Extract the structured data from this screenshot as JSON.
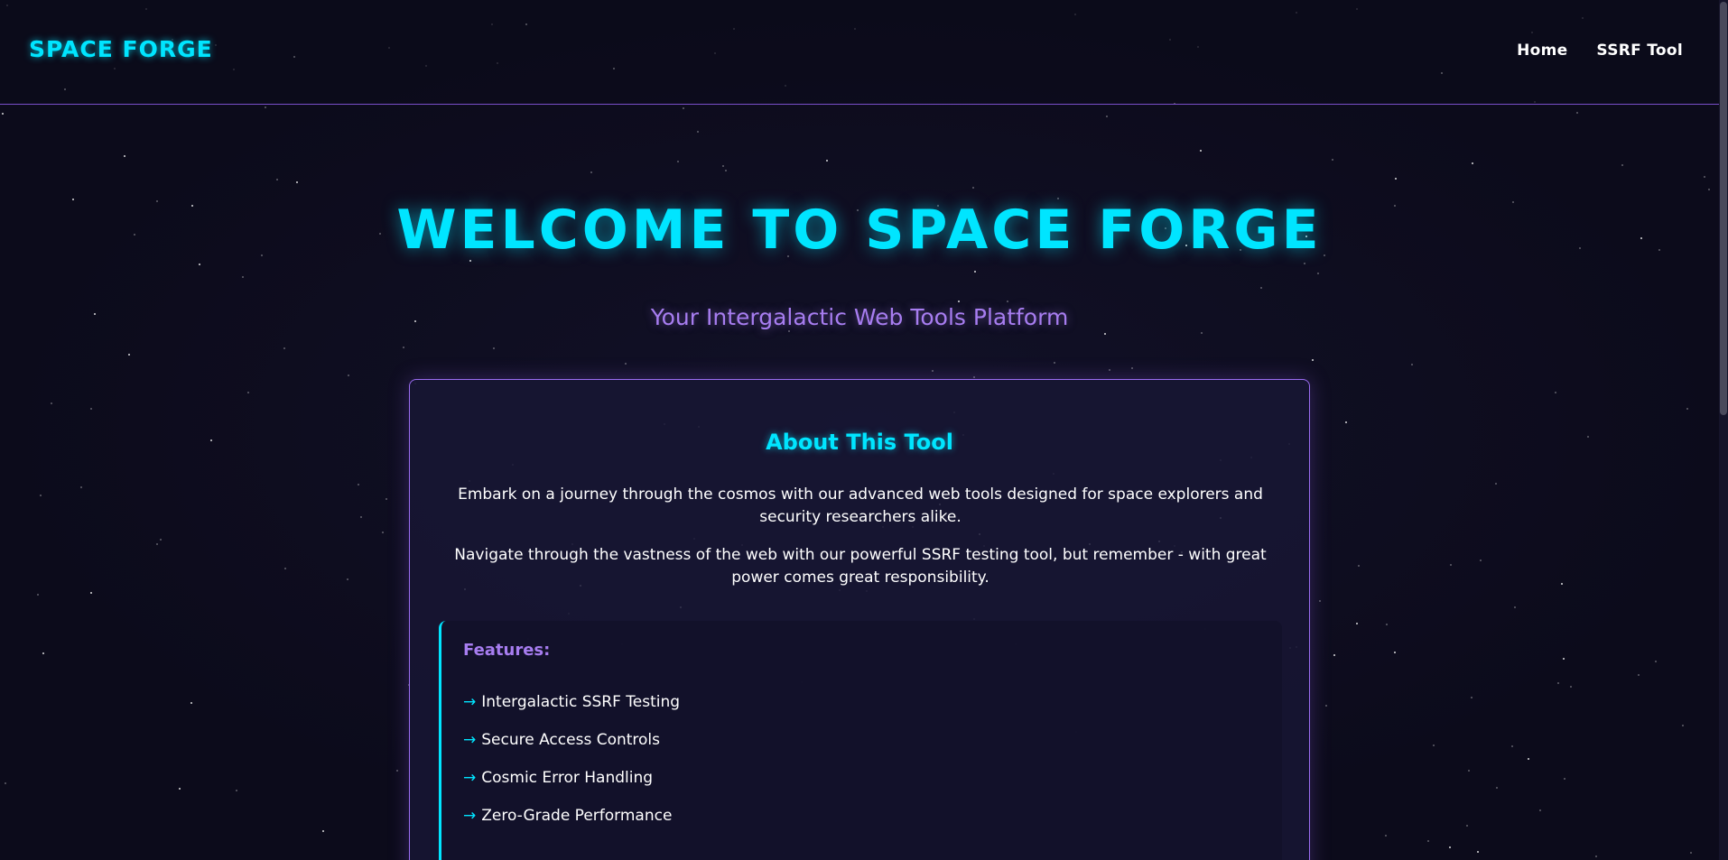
{
  "header": {
    "logo": "SPACE FORGE",
    "nav": [
      {
        "label": "Home"
      },
      {
        "label": "SSRF Tool"
      }
    ]
  },
  "hero": {
    "title": "WELCOME TO SPACE FORGE",
    "subtitle": "Your Intergalactic Web Tools Platform"
  },
  "about": {
    "title": "About This Tool",
    "paragraph1": "Embark on a journey through the cosmos with our advanced web tools designed for space explorers and security researchers alike.",
    "paragraph2": "Navigate through the vastness of the web with our powerful SSRF testing tool, but remember - with great power comes great responsibility."
  },
  "features": {
    "title": "Features:",
    "arrow_glyph": "→",
    "items": [
      {
        "label": "Intergalactic SSRF Testing"
      },
      {
        "label": "Secure Access Controls"
      },
      {
        "label": "Cosmic Error Handling"
      },
      {
        "label": "Zero-Grade Performance"
      }
    ]
  },
  "colors": {
    "background": "#0c0b1b",
    "accent_cyan": "#00e5ff",
    "accent_purple": "#a77df0",
    "border_purple": "#9a6cf0"
  }
}
